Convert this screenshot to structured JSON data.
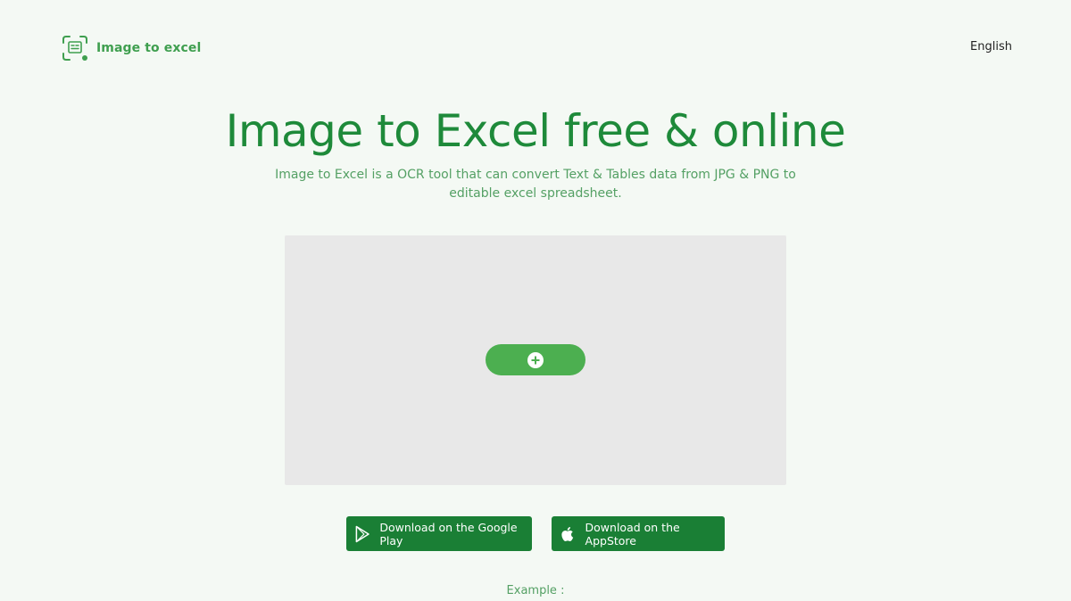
{
  "header": {
    "logo_text": "Image to excel",
    "language": "English"
  },
  "hero": {
    "title": "Image to Excel free & online",
    "subtitle": "Image to Excel is a OCR tool that can convert Text & Tables data from JPG & PNG to editable excel spreadsheet."
  },
  "upload": {
    "add_button_icon": "plus-circle-icon"
  },
  "downloads": {
    "google_play_label": "Download on the Google Play",
    "google_play_icon": "google-play-icon",
    "appstore_label": "Download on the AppStore",
    "appstore_icon": "apple-icon"
  },
  "example_label": "Example :",
  "colors": {
    "brand_green": "#1e8a3a",
    "button_green": "#4caf50",
    "store_green": "#1a7f35",
    "background": "#f4f9f4",
    "dropzone": "#e8e8e8"
  }
}
